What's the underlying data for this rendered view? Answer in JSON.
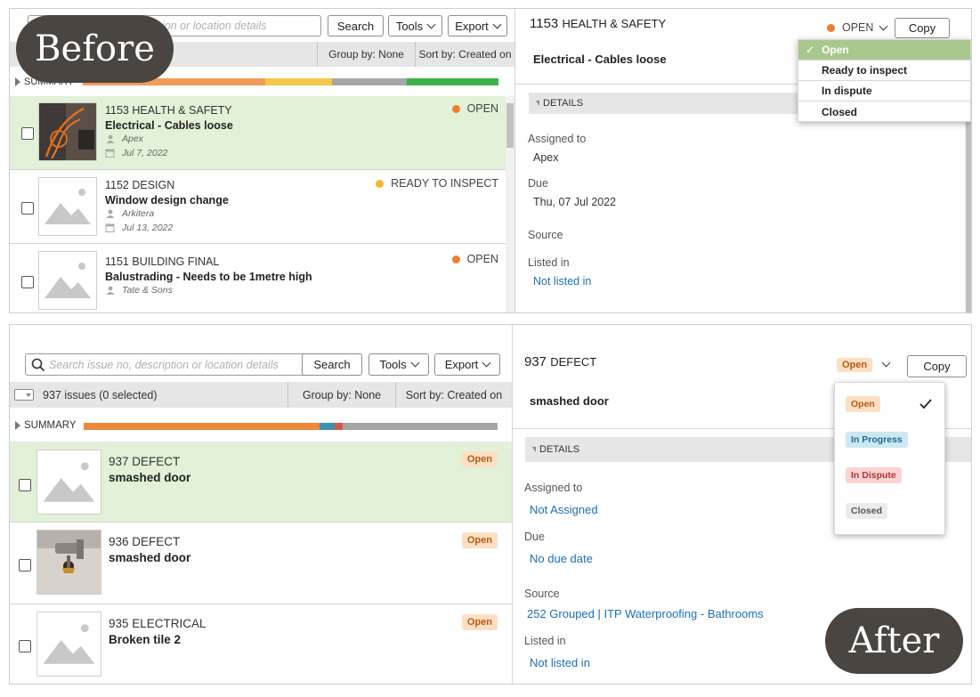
{
  "captions": {
    "before": "Before",
    "after": "After"
  },
  "before": {
    "search": {
      "placeholder_tail": "ion or location details"
    },
    "buttons": {
      "search": "Search",
      "tools": "Tools",
      "export": "Export",
      "copy": "Copy"
    },
    "subbar": {
      "group_by": "Group by: None",
      "sort_by": "Sort by: Created on"
    },
    "summary": {
      "label": "SUMMARY",
      "bar": [
        {
          "color": "#f39b5b",
          "fraction": 0.44
        },
        {
          "color": "#f5c749",
          "fraction": 0.16
        },
        {
          "color": "#a7a7a7",
          "fraction": 0.18
        },
        {
          "color": "#3cb449",
          "fraction": 0.22
        }
      ]
    },
    "issues": [
      {
        "number": "1153 HEALTH & SAFETY",
        "title": "Electrical - Cables loose",
        "assignee": "Apex",
        "date": "Jul 7, 2022",
        "status": "OPEN",
        "status_color": "#f07f2d",
        "selected": true,
        "thumb": "photo-cables"
      },
      {
        "number": "1152 DESIGN",
        "title": "Window design change",
        "assignee": "Arkitera",
        "date": "Jul 13, 2022",
        "status": "READY TO INSPECT",
        "status_color": "#f5b82e",
        "selected": false,
        "thumb": "placeholder"
      },
      {
        "number": "1151 BUILDING FINAL",
        "title": "Balustrading - Needs to be 1metre high",
        "assignee": "Tate & Sons",
        "date": "",
        "status": "OPEN",
        "status_color": "#f07f2d",
        "selected": false,
        "thumb": "placeholder"
      }
    ],
    "detail": {
      "number": "1153",
      "category": "HEALTH & SAFETY",
      "title": "Electrical - Cables loose",
      "status": "OPEN",
      "status_color": "#f07f2d",
      "section": "DETAILS",
      "assigned_label": "Assigned to",
      "assigned_value": "Apex",
      "due_label": "Due",
      "due_value": "Thu, 07 Jul 2022",
      "source_label": "Source",
      "listed_label": "Listed in",
      "listed_value": "Not listed in"
    },
    "dropdown": [
      {
        "label": "Open",
        "active": true
      },
      {
        "label": "Ready to inspect",
        "active": false
      },
      {
        "label": "In dispute",
        "active": false
      },
      {
        "label": "Closed",
        "active": false
      }
    ]
  },
  "after": {
    "search": {
      "placeholder": "Search issue no, description or location details"
    },
    "buttons": {
      "search": "Search",
      "tools": "Tools",
      "export": "Export",
      "copy": "Copy"
    },
    "subbar": {
      "count": "937 issues  (0 selected)",
      "group_by": "Group by: None",
      "sort_by": "Sort by: Created on"
    },
    "summary": {
      "label": "SUMMARY",
      "bar": [
        {
          "color": "#ec8a3a",
          "fraction": 0.57
        },
        {
          "color": "#3f8fb1",
          "fraction": 0.036
        },
        {
          "color": "#d25a4a",
          "fraction": 0.02
        },
        {
          "color": "#a6a6a6",
          "fraction": 0.374
        }
      ]
    },
    "issues": [
      {
        "number": "937 DEFECT",
        "title": "smashed door",
        "status": "Open",
        "selected": true,
        "thumb": "placeholder"
      },
      {
        "number": "936 DEFECT",
        "title": "smashed door",
        "status": "Open",
        "selected": false,
        "thumb": "photo-door"
      },
      {
        "number": "935 ELECTRICAL",
        "title": "Broken tile 2",
        "status": "Open",
        "selected": false,
        "thumb": "placeholder"
      }
    ],
    "detail": {
      "number": "937",
      "category": "DEFECT",
      "title": "smashed door",
      "status": "Open",
      "section": "DETAILS",
      "assigned_label": "Assigned to",
      "assigned_value": "Not Assigned",
      "due_label": "Due",
      "due_value": "No due date",
      "source_label": "Source",
      "source_value": "252 Grouped | ITP Waterproofing - Bathrooms",
      "listed_label": "Listed in",
      "listed_value": "Not listed in"
    },
    "dropdown": [
      {
        "label": "Open",
        "style": "open",
        "checked": true
      },
      {
        "label": "In Progress",
        "style": "prog",
        "checked": false
      },
      {
        "label": "In Dispute",
        "style": "disp",
        "checked": false
      },
      {
        "label": "Closed",
        "style": "closed",
        "checked": false
      }
    ]
  }
}
